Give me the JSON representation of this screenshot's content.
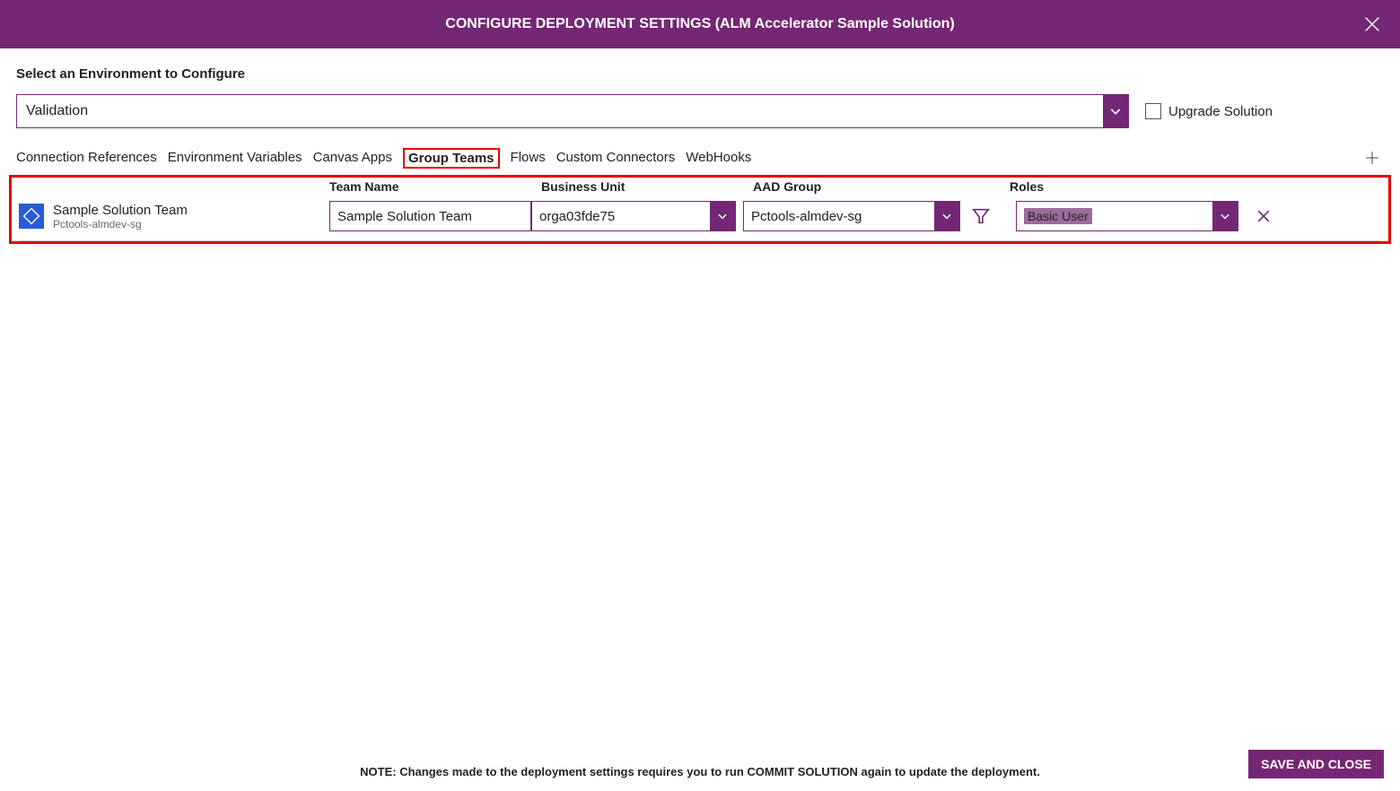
{
  "header": {
    "title": "CONFIGURE DEPLOYMENT SETTINGS (ALM Accelerator Sample Solution)"
  },
  "environment": {
    "label": "Select an Environment to Configure",
    "value": "Validation",
    "upgrade_label": "Upgrade Solution"
  },
  "tabs": [
    {
      "label": "Connection References",
      "active": false
    },
    {
      "label": "Environment Variables",
      "active": false
    },
    {
      "label": "Canvas Apps",
      "active": false
    },
    {
      "label": "Group Teams",
      "active": true
    },
    {
      "label": "Flows",
      "active": false
    },
    {
      "label": "Custom Connectors",
      "active": false
    },
    {
      "label": "WebHooks",
      "active": false
    }
  ],
  "columns": {
    "team_name": "Team Name",
    "business_unit": "Business Unit",
    "aad_group": "AAD Group",
    "roles": "Roles"
  },
  "rows": [
    {
      "title": "Sample Solution Team",
      "subtitle": "Pctools-almdev-sg",
      "team_name": "Sample Solution Team",
      "business_unit": "orga03fde75",
      "aad_group": "Pctools-almdev-sg",
      "role": "Basic User"
    }
  ],
  "footer": {
    "note": "NOTE: Changes made to the deployment settings requires you to run COMMIT SOLUTION again to update the deployment.",
    "save_label": "SAVE AND CLOSE"
  }
}
